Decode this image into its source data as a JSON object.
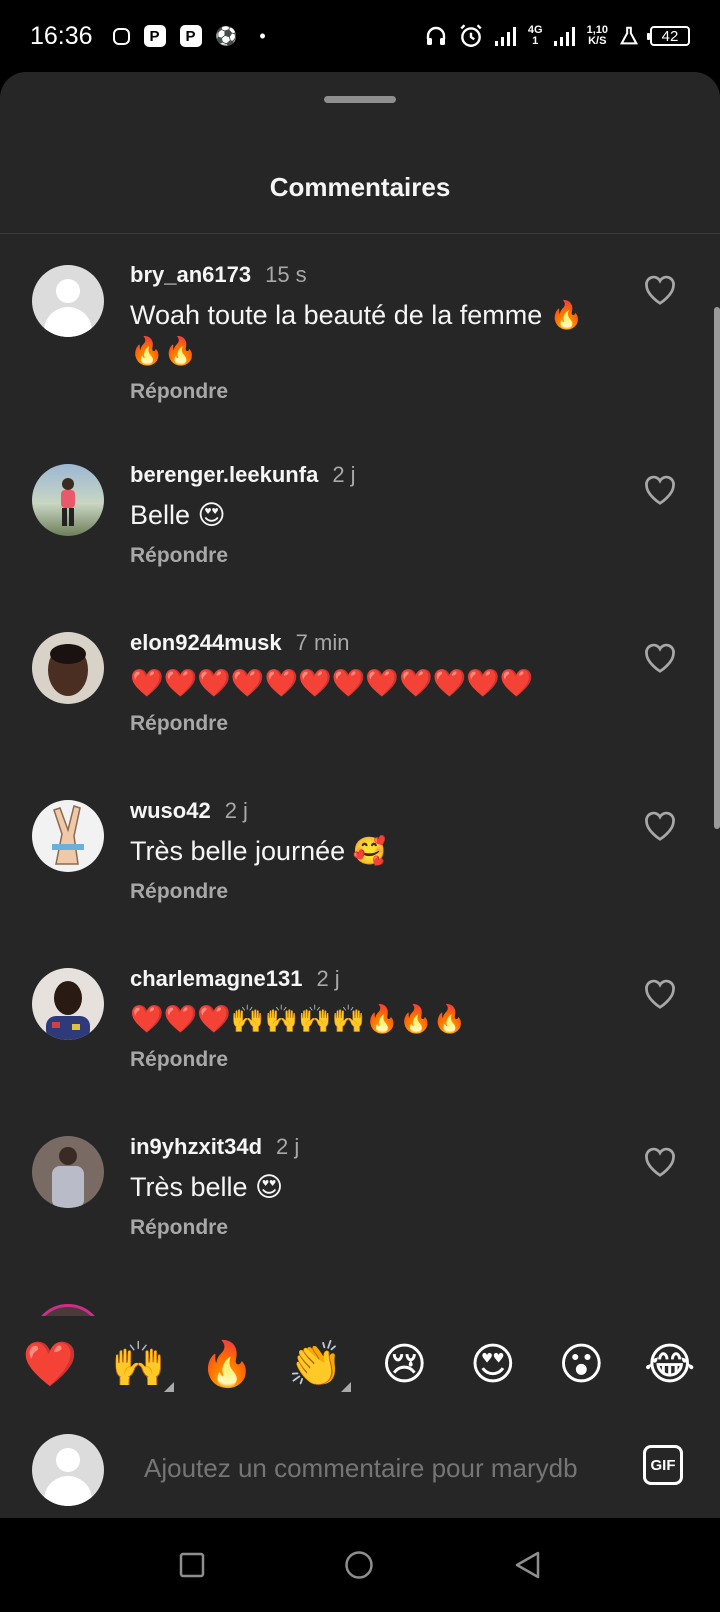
{
  "status_bar": {
    "time": "16:36",
    "network": "4G",
    "network_sub": "1",
    "speed_value": "1,10",
    "speed_unit": "K/S",
    "battery": "42"
  },
  "sheet": {
    "title": "Commentaires"
  },
  "comments": [
    {
      "username": "bry_an6173",
      "time": "15 s",
      "text": "Woah toute la beauté de la femme 🔥🔥🔥",
      "reply": "Répondre",
      "avatar": "default"
    },
    {
      "username": "berenger.leekunfa",
      "time": "2 j",
      "text": "Belle 😍",
      "reply": "Répondre",
      "avatar": "photo"
    },
    {
      "username": "elon9244musk",
      "time": "7 min",
      "text": "❤️❤️❤️❤️❤️❤️❤️❤️❤️❤️❤️❤️",
      "reply": "Répondre",
      "avatar": "photo"
    },
    {
      "username": "wuso42",
      "time": "2 j",
      "text": "Très belle journée 🥰",
      "reply": "Répondre",
      "avatar": "photo"
    },
    {
      "username": "charlemagne131",
      "time": "2 j",
      "text": "❤️❤️❤️🙌🙌🙌🙌🔥🔥🔥",
      "reply": "Répondre",
      "avatar": "photo"
    },
    {
      "username": "in9yhzxit34d",
      "time": "2 j",
      "text": "Très belle 😍",
      "reply": "Répondre",
      "avatar": "photo"
    }
  ],
  "emoji_bar": [
    "❤️",
    "🙌",
    "🔥",
    "👏",
    "😢",
    "😍",
    "😮",
    "😂"
  ],
  "composer": {
    "placeholder": "Ajoutez un commentaire pour marydb",
    "gif_label": "GIF"
  },
  "icons": {
    "like": "heart-outline-icon",
    "gif": "gif-icon",
    "nav_recents": "square-icon",
    "nav_home": "circle-icon",
    "nav_back": "triangle-back-icon"
  }
}
